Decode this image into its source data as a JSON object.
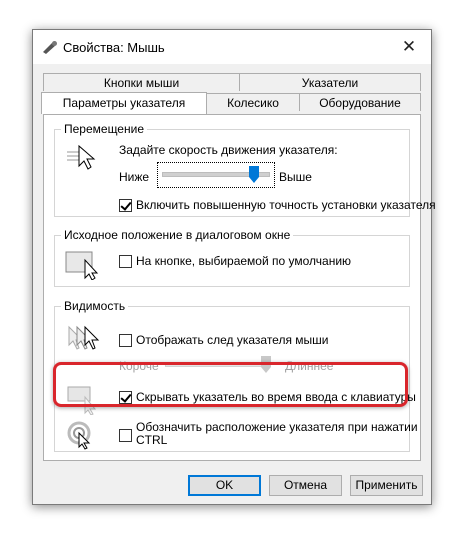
{
  "window": {
    "title": "Свойства: Мышь",
    "title_icon": "mouse-settings-icon",
    "close_glyph": "✕"
  },
  "tabs": {
    "row1": [
      "Кнопки мыши",
      "Указатели"
    ],
    "row2": [
      "Параметры указателя",
      "Колесико",
      "Оборудование"
    ],
    "active": "Параметры указателя"
  },
  "movement": {
    "legend": "Перемещение",
    "speed_label": "Задайте скорость движения указателя:",
    "slow": "Ниже",
    "fast": "Выше",
    "speed_level": 0.9,
    "precision_label": "Включить повышенную точность установки указателя",
    "precision_checked": true,
    "icon": "pointer-speed-icon"
  },
  "snap": {
    "legend": "Исходное положение в диалоговом окне",
    "label": "На кнопке, выбираемой по умолчанию",
    "checked": false,
    "icon": "snap-to-button-icon"
  },
  "visibility": {
    "legend": "Видимость",
    "trails_label": "Отображать след указателя мыши",
    "trails_checked": false,
    "short": "Короче",
    "long": "Длиннее",
    "trails_level": 1.0,
    "hide_label": "Скрывать указатель во время ввода с клавиатуры",
    "hide_checked": true,
    "ctrl_label_line1": "Обозначить расположение указателя при нажатии",
    "ctrl_label_line2": "CTRL",
    "ctrl_checked": false,
    "icons": [
      "pointer-trails-icon",
      "hide-pointer-icon",
      "locate-pointer-icon"
    ]
  },
  "buttons": {
    "ok": "OK",
    "cancel": "Отмена",
    "apply": "Применить"
  },
  "colors": {
    "accent": "#0078d7",
    "highlight": "#d9262c"
  }
}
